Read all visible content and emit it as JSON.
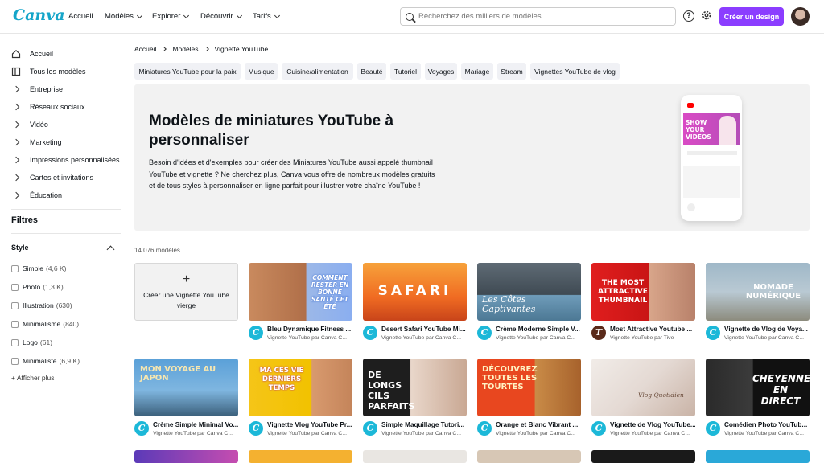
{
  "header": {
    "logo": "Canva",
    "nav": [
      {
        "label": "Accueil"
      },
      {
        "label": "Modèles"
      },
      {
        "label": "Explorer"
      },
      {
        "label": "Découvrir"
      },
      {
        "label": "Tarifs"
      }
    ],
    "search_placeholder": "Recherchez des milliers de modèles",
    "help_icon": "?",
    "create_button": "Créer un design",
    "accent": "#8b3dff"
  },
  "sidebar": {
    "items": [
      {
        "label": "Accueil",
        "icon": "home-icon"
      },
      {
        "label": "Tous les modèles",
        "icon": "templates-icon"
      },
      {
        "label": "Entreprise",
        "icon": "chevron-right-icon"
      },
      {
        "label": "Réseaux sociaux",
        "icon": "chevron-right-icon"
      },
      {
        "label": "Vidéo",
        "icon": "chevron-right-icon"
      },
      {
        "label": "Marketing",
        "icon": "chevron-right-icon"
      },
      {
        "label": "Impressions personnalisées",
        "icon": "chevron-right-icon"
      },
      {
        "label": "Cartes et invitations",
        "icon": "chevron-right-icon"
      },
      {
        "label": "Éducation",
        "icon": "chevron-right-icon"
      }
    ],
    "filters_title": "Filtres",
    "style_title": "Style",
    "style_options": [
      {
        "label": "Simple",
        "count": "(4,6 K)"
      },
      {
        "label": "Photo",
        "count": "(1,3 K)"
      },
      {
        "label": "Illustration",
        "count": "(630)"
      },
      {
        "label": "Minimalisme",
        "count": "(840)"
      },
      {
        "label": "Logo",
        "count": "(61)"
      },
      {
        "label": "Minimaliste",
        "count": "(6,9 K)"
      }
    ],
    "show_more": "+ Afficher plus"
  },
  "breadcrumb": [
    "Accueil",
    "Modèles",
    "Vignette YouTube"
  ],
  "pills": [
    "Miniatures YouTube pour la paix",
    "Musique",
    "Cuisine/alimentation",
    "Beauté",
    "Tutoriel",
    "Voyages",
    "Mariage",
    "Stream",
    "Vignettes YouTube de vlog"
  ],
  "hero": {
    "title": "Modèles de miniatures YouTube à personnaliser",
    "description": "Besoin d'idées et d'exemples pour créer des Miniatures YouTube aussi appelé thumbnail YouTube et vignette ? Ne cherchez plus, Canva vous offre de nombreux modèles gratuits et de tous styles à personnaliser en ligne parfait pour illustrer votre chaîne YouTube !",
    "phone_text": "SHOW YOUR VIDEOS"
  },
  "results_count": "14 076 modèles",
  "create_card": {
    "plus": "+",
    "label": "Créer une Vignette YouTube vierge"
  },
  "row1": [
    {
      "title": "Bleu Dynamique Fitness ...",
      "sub": "Vignette YouTube par Canva C...",
      "overlay": "COMMENT RESTER EN BONNE SANTÉ CET ÉTÉ"
    },
    {
      "title": "Desert Safari YouTube Mi...",
      "sub": "Vignette YouTube par Canva C...",
      "overlay": "SAFARI"
    },
    {
      "title": "Crème Moderne Simple V...",
      "sub": "Vignette YouTube par Canva C...",
      "overlay": "Les Côtes Captivantes"
    },
    {
      "title": "Most Attractive Youtube ...",
      "sub": "Vignette YouTube par Tive",
      "overlay": "THE MOST ATTRACTIVE THUMBNAIL"
    },
    {
      "title": "Vignette de Vlog de Voya...",
      "sub": "Vignette YouTube par Canva C...",
      "overlay": "NOMADE NUMÉRIQUE"
    }
  ],
  "row2": [
    {
      "title": "Crème Simple Minimal Vo...",
      "sub": "Vignette YouTube par Canva C...",
      "overlay": "MON VOYAGE AU JAPON"
    },
    {
      "title": "Vignette Vlog YouTube Pr...",
      "sub": "Vignette YouTube par Canva C...",
      "overlay": "MA CES VIE DERNIERS TEMPS"
    },
    {
      "title": "Simple Maquillage Tutori...",
      "sub": "Vignette YouTube par Canva C...",
      "overlay": "DE LONGS CILS PARFAITS"
    },
    {
      "title": "Orange et Blanc Vibrant ...",
      "sub": "Vignette YouTube par Canva C...",
      "overlay": "DÉCOUVREZ TOUTES LES TOURTES"
    },
    {
      "title": "Vignette de Vlog YouTube...",
      "sub": "Vignette YouTube par Canva C...",
      "overlay": "Vlog Quotidien"
    },
    {
      "title": "Comédien Photo YouTub...",
      "sub": "Vignette YouTube par Canva C...",
      "overlay": "CHEYENNE EN DIRECT"
    }
  ]
}
